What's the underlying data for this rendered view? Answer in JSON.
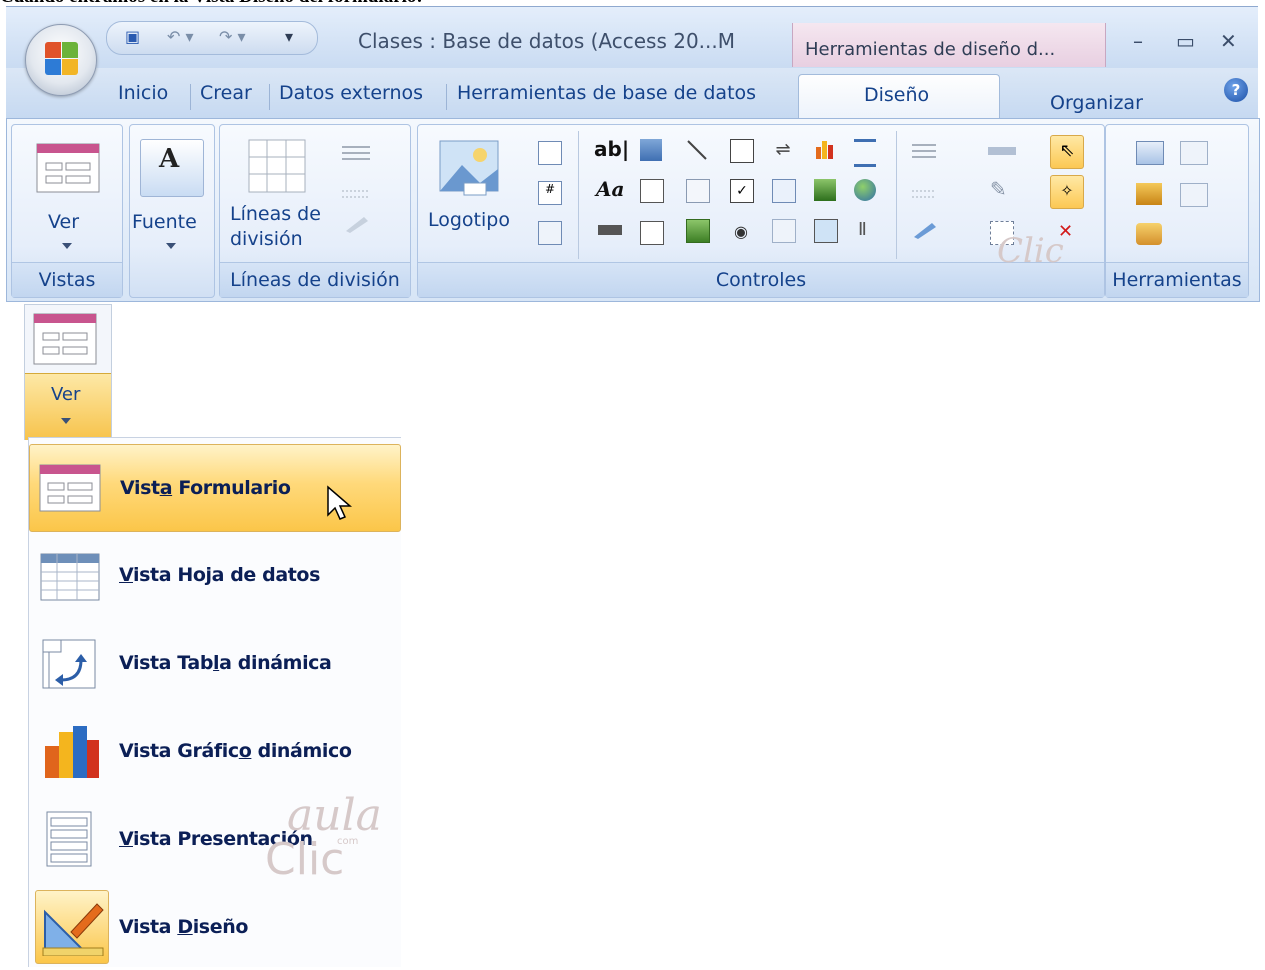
{
  "caption": "Cuando entramos en la Vista Diseño del formulario:",
  "window": {
    "title": "Clases : Base de datos (Access 20...M",
    "context_tab": "Herramientas de diseño d...",
    "minimize": "–",
    "maximize": "▭",
    "close": "✕"
  },
  "tabs": [
    "Inicio",
    "Crear",
    "Datos externos",
    "Herramientas de base de datos",
    "Diseño",
    "Organizar"
  ],
  "active_tab": "Diseño",
  "help_icon": "?",
  "ribbon": {
    "vistas": {
      "group_label": "Vistas",
      "ver_label": "Ver"
    },
    "fuente": {
      "label": "Fuente",
      "icon_text": "A"
    },
    "lineas": {
      "group_label": "Líneas de división",
      "btn_line1": "Líneas de",
      "btn_line2": "división"
    },
    "controles": {
      "group_label": "Controles",
      "logotipo_label": "Logotipo",
      "text_ctl": "ab|",
      "label_ctl": "Aa"
    },
    "herramientas": {
      "group_label": "Herramientas"
    }
  },
  "view_button": {
    "label": "Ver"
  },
  "menu": {
    "items": [
      {
        "label_pre": "Vist",
        "label_u": "a",
        "label_post": " Formulario",
        "icon": "form-view-icon",
        "highlighted": true
      },
      {
        "label_pre": "",
        "label_u": "V",
        "label_post": "ista Hoja de datos",
        "icon": "datasheet-view-icon",
        "highlighted": false
      },
      {
        "label_pre": "Vista Tab",
        "label_u": "l",
        "label_post": "a dinámica",
        "icon": "pivot-table-view-icon",
        "highlighted": false
      },
      {
        "label_pre": "Vista Gráfic",
        "label_u": "o",
        "label_post": " dinámico",
        "icon": "pivot-chart-view-icon",
        "highlighted": false
      },
      {
        "label_pre": "",
        "label_u": "V",
        "label_post": "ista Presentación",
        "icon": "layout-view-icon",
        "highlighted": false
      },
      {
        "label_pre": "Vista ",
        "label_u": "D",
        "label_post": "iseño",
        "icon": "design-view-icon",
        "highlighted": false
      }
    ]
  },
  "watermark": {
    "top": "aula",
    "bottom": "Clic",
    "small": "com"
  },
  "colors": {
    "accent_text": "#15428b",
    "highlight": "#fbc649",
    "menu_text": "#0b1f56"
  }
}
